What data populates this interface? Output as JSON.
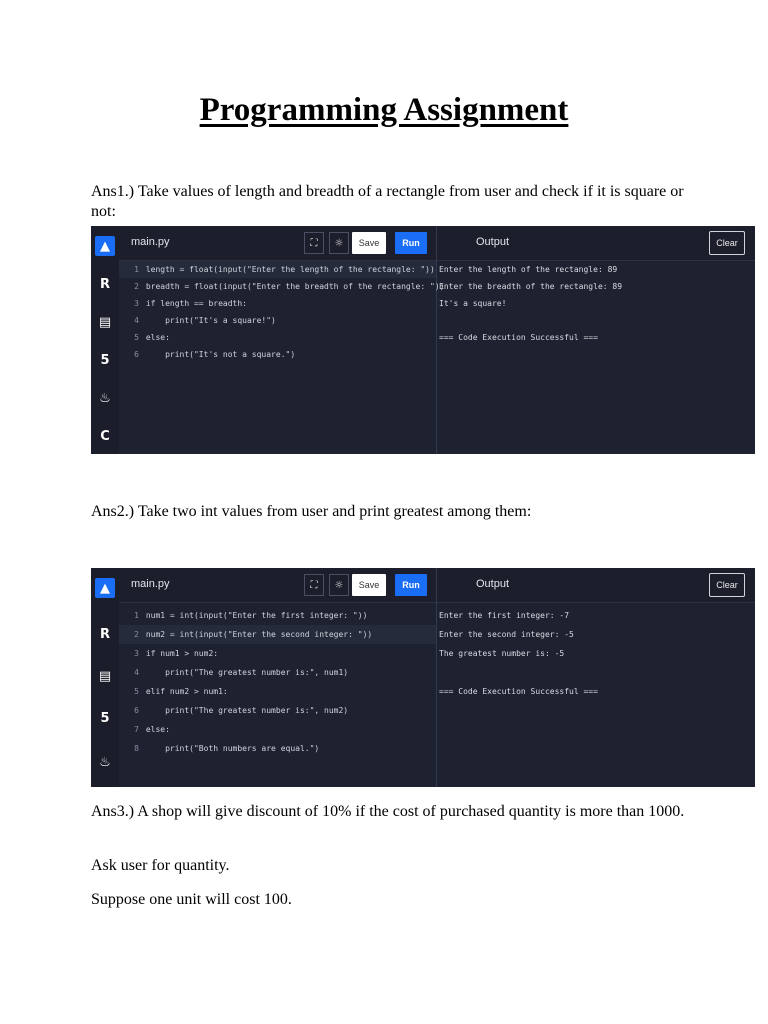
{
  "title": "Programming Assignment",
  "q1": {
    "text": "Ans1.) Take values of length and breadth of a rectangle from user and check if it is square or not:",
    "editor": {
      "filename": "main.py",
      "save_label": "Save",
      "run_label": "Run",
      "output_label": "Output",
      "clear_label": "Clear",
      "code": [
        {
          "n": "1",
          "text": "length = float(input(\"Enter the length of the rectangle: \"))"
        },
        {
          "n": "2",
          "text": "breadth = float(input(\"Enter the breadth of the rectangle: \"))"
        },
        {
          "n": "3",
          "text": "if length == breadth:"
        },
        {
          "n": "4",
          "text": "    print(\"It's a square!\")"
        },
        {
          "n": "5",
          "text": "else:"
        },
        {
          "n": "6",
          "text": "    print(\"It's not a square.\")"
        }
      ],
      "output": [
        "Enter the length of the rectangle: 89",
        "Enter the breadth of the rectangle: 89",
        "It's a square!",
        "",
        "=== Code Execution Successful ==="
      ],
      "sidebar_icons": [
        "python-icon",
        "r-icon",
        "database-icon",
        "html5-icon",
        "java-icon",
        "c-icon"
      ]
    }
  },
  "q2": {
    "text": "Ans2.) Take two int values from user and print greatest among them:",
    "editor": {
      "filename": "main.py",
      "save_label": "Save",
      "run_label": "Run",
      "output_label": "Output",
      "clear_label": "Clear",
      "code": [
        {
          "n": "1",
          "text": "num1 = int(input(\"Enter the first integer: \"))"
        },
        {
          "n": "2",
          "text": "num2 = int(input(\"Enter the second integer: \"))"
        },
        {
          "n": "3",
          "text": "if num1 > num2:"
        },
        {
          "n": "4",
          "text": "    print(\"The greatest number is:\", num1)"
        },
        {
          "n": "5",
          "text": "elif num2 > num1:"
        },
        {
          "n": "6",
          "text": "    print(\"The greatest number is:\", num2)"
        },
        {
          "n": "7",
          "text": "else:"
        },
        {
          "n": "8",
          "text": "    print(\"Both numbers are equal.\")"
        }
      ],
      "output": [
        "Enter the first integer: -7",
        "Enter the second integer: -5",
        "The greatest number is: -5",
        "",
        "=== Code Execution Successful ==="
      ],
      "sidebar_icons": [
        "python-icon",
        "r-icon",
        "database-icon",
        "html5-icon",
        "java-icon"
      ]
    }
  },
  "q3": {
    "text": "Ans3.) A shop will give discount of 10% if the cost of purchased quantity is more than 1000.",
    "line2": "Ask user for quantity.",
    "line3": "Suppose one unit will cost 100."
  }
}
